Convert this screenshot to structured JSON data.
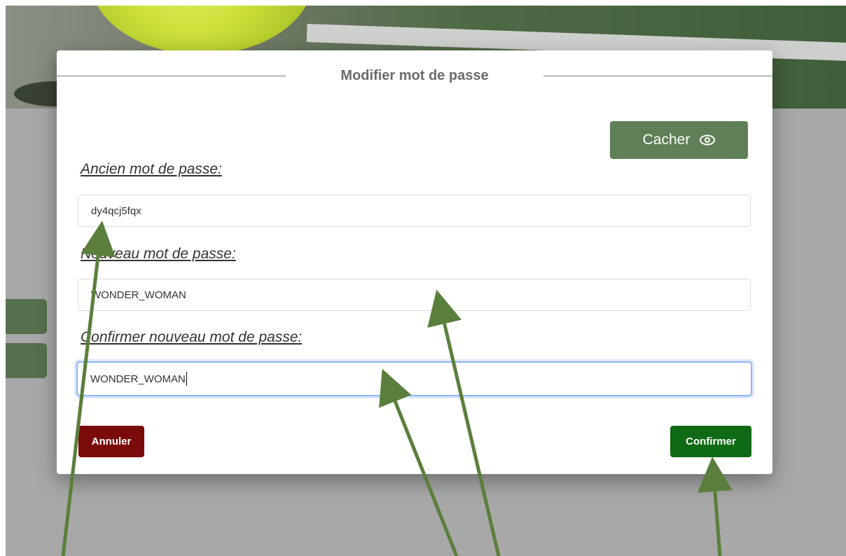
{
  "modal": {
    "title": "Modifier mot de passe",
    "toggle_label": "Cacher",
    "toggle_icon": "eye-icon",
    "fields": {
      "old_label": "Ancien mot de passe:",
      "old_value": "dy4qcj5fqx",
      "new_label": "Nouveau mot de passe:",
      "new_value": "WONDER_WOMAN",
      "confirm_label": "Confirmer nouveau mot de passe:",
      "confirm_value": "WONDER_WOMAN"
    },
    "cancel_label": "Annuler",
    "confirm_label": "Confirmer"
  },
  "colors": {
    "cancel": "#7b0a0a",
    "confirm": "#0e6a14",
    "toggle": "#5f7f57",
    "arrow": "#5a7f3c"
  }
}
